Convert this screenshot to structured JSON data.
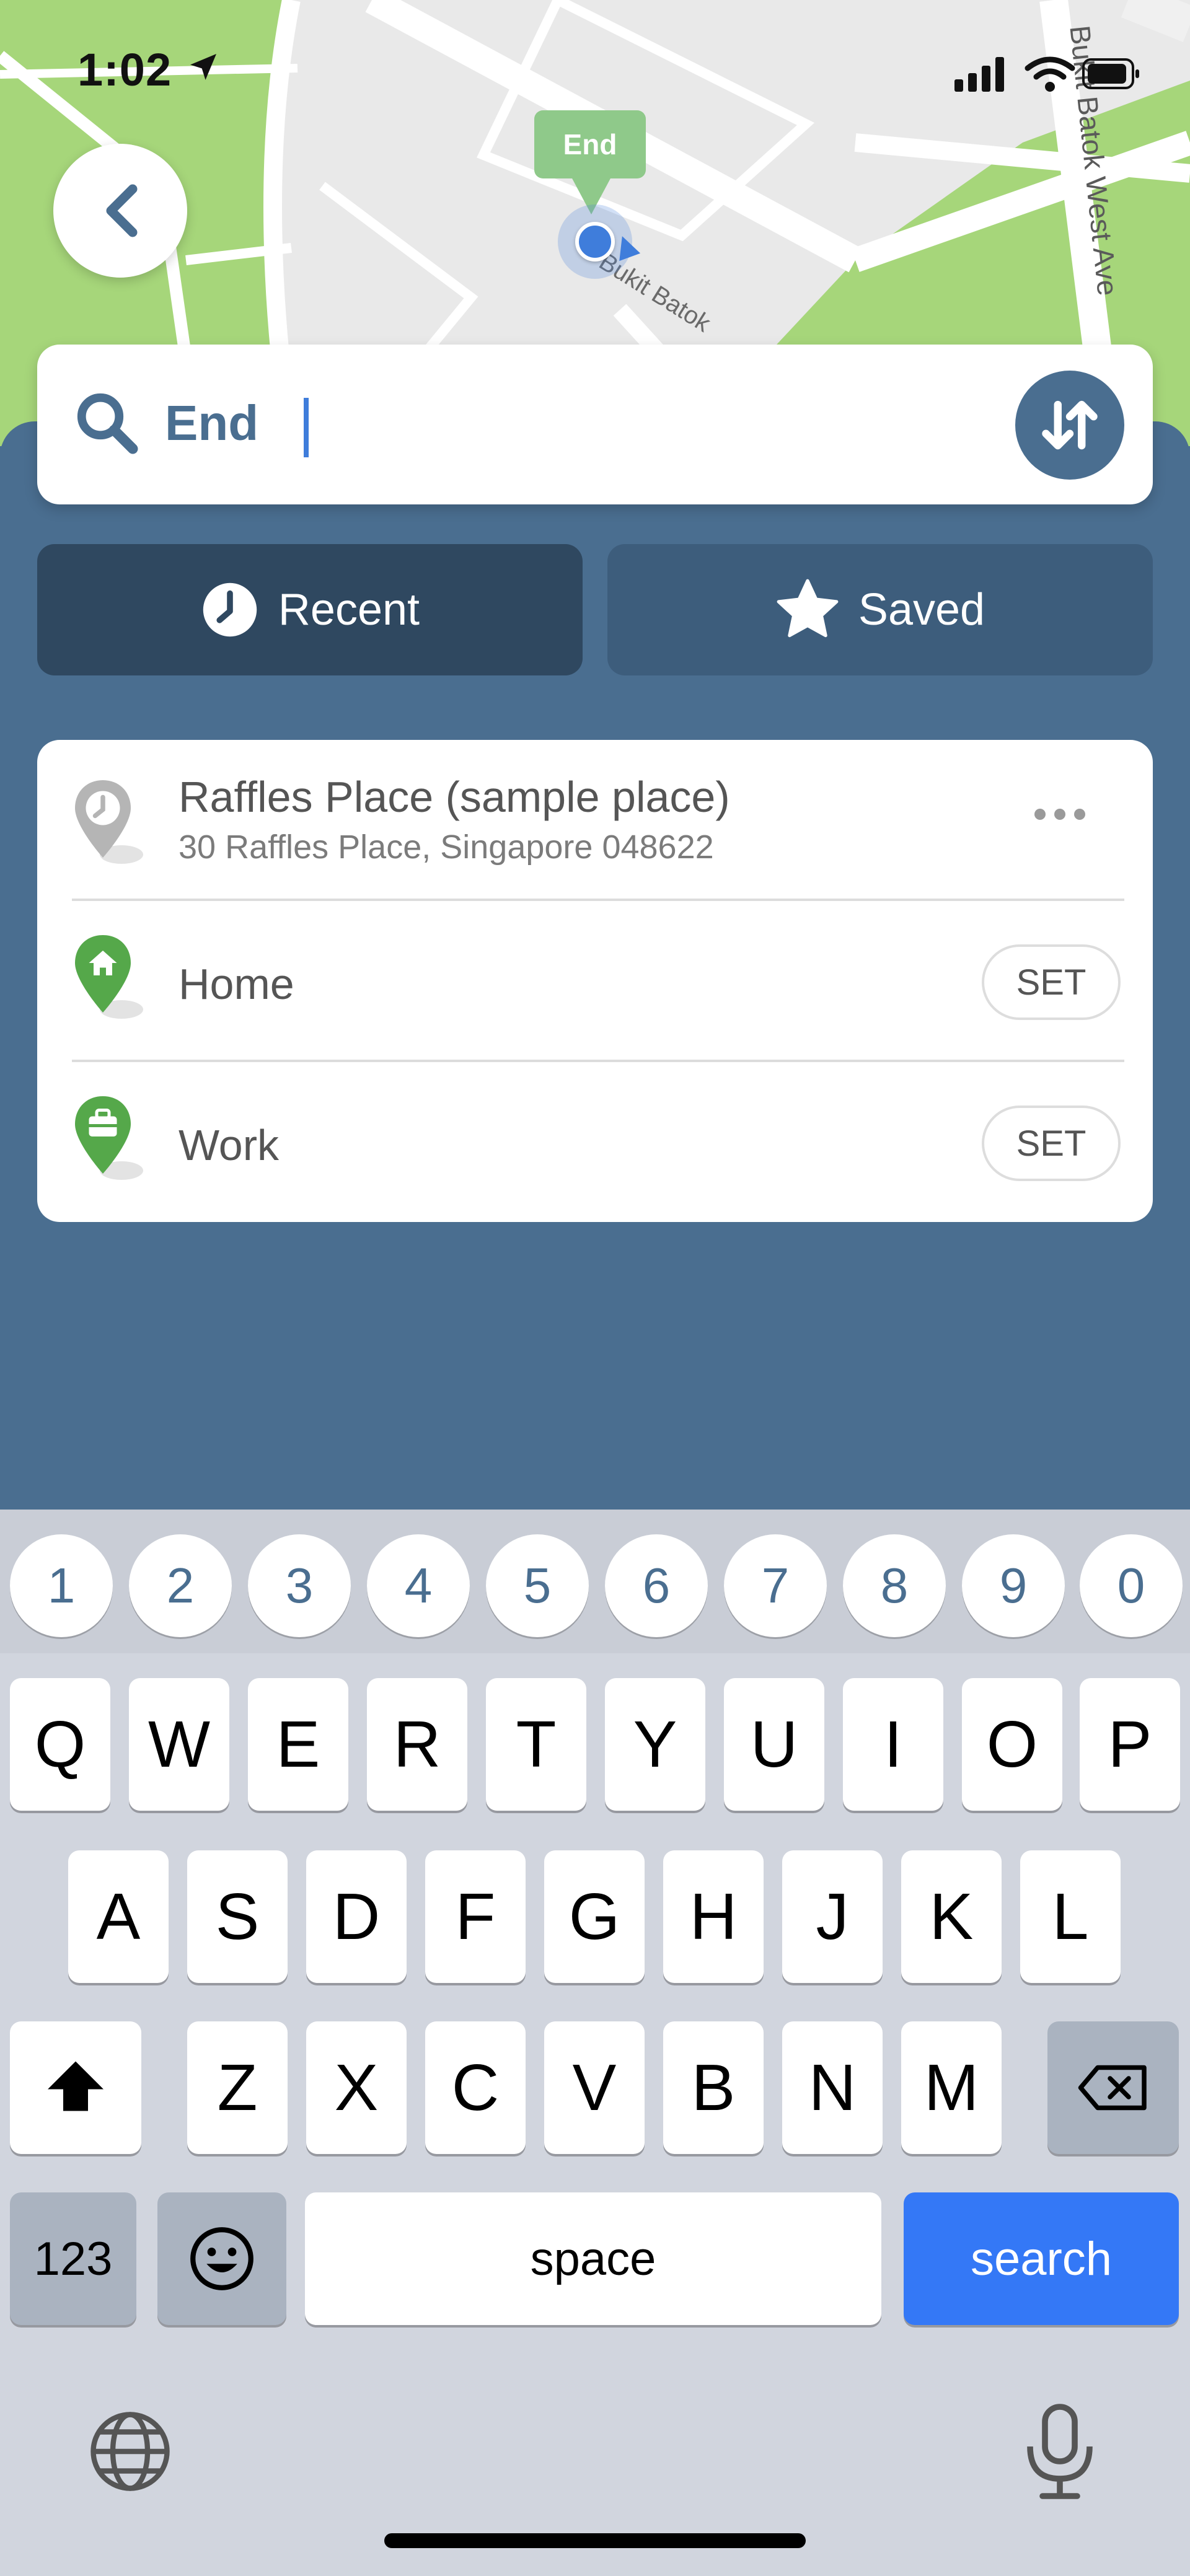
{
  "status_bar": {
    "time": "1:02"
  },
  "map": {
    "street_vertical": "Bukit Batok West Ave",
    "street_diagonal": "Bukit Batok",
    "pin_label": "End"
  },
  "search": {
    "value": "End",
    "placeholder": ""
  },
  "tabs": [
    {
      "label": "Recent",
      "active": true
    },
    {
      "label": "Saved",
      "active": false
    }
  ],
  "list": {
    "recent_place": {
      "title": "Raffles Place (sample place)",
      "subtitle": "30 Raffles Place, Singapore 048622"
    },
    "home": {
      "label": "Home",
      "action": "SET"
    },
    "work": {
      "label": "Work",
      "action": "SET"
    }
  },
  "keyboard": {
    "numbers": [
      "1",
      "2",
      "3",
      "4",
      "5",
      "6",
      "7",
      "8",
      "9",
      "0"
    ],
    "row1": [
      "Q",
      "W",
      "E",
      "R",
      "T",
      "Y",
      "U",
      "I",
      "O",
      "P"
    ],
    "row2": [
      "A",
      "S",
      "D",
      "F",
      "G",
      "H",
      "J",
      "K",
      "L"
    ],
    "row3": [
      "Z",
      "X",
      "C",
      "V",
      "B",
      "N",
      "M"
    ],
    "mode_key": "123",
    "space": "space",
    "action": "search"
  },
  "colors": {
    "panel": "#4a6e90",
    "active_tab": "#2f4860",
    "map_green": "#a6d67a",
    "pin_green": "#55a84a",
    "search_key": "#3478f6"
  }
}
